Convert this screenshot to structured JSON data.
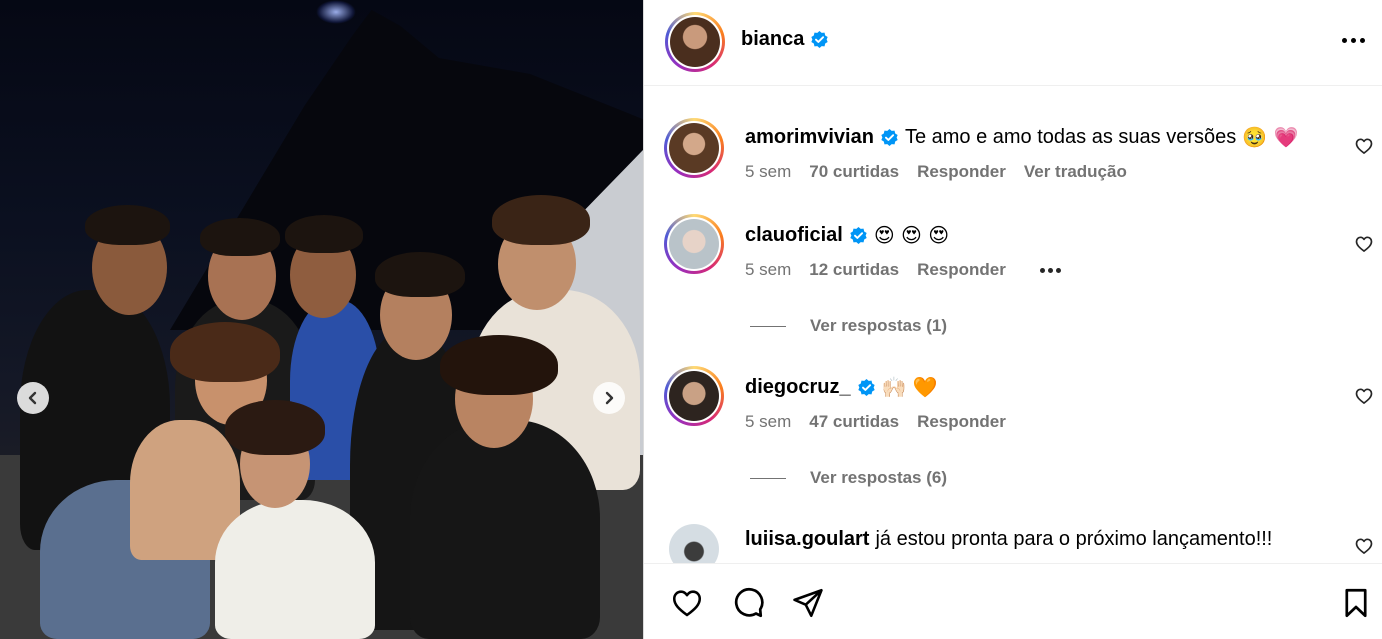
{
  "post": {
    "username": "bianca",
    "verified": true
  },
  "comments": [
    {
      "username": "amorimvivian",
      "verified": true,
      "text": "Te amo e amo todas as suas versões",
      "emoji": "🥹 💗",
      "age": "5 sem",
      "likes": "70 curtidas",
      "reply": "Responder",
      "translate": "Ver tradução"
    },
    {
      "username": "clauoficial",
      "verified": true,
      "text": "",
      "emoji": "😍 😍 😍",
      "age": "5 sem",
      "likes": "12 curtidas",
      "reply": "Responder",
      "view_replies": "Ver respostas (1)"
    },
    {
      "username": "diegocruz_",
      "verified": true,
      "text": "",
      "emoji": "🙌🏻 🧡",
      "age": "5 sem",
      "likes": "47 curtidas",
      "reply": "Responder",
      "view_replies": "Ver respostas (6)"
    },
    {
      "username": "luiisa.goulart",
      "verified": false,
      "text": "já estou pronta para o próximo lançamento!!!"
    }
  ],
  "icons": {
    "like": "heart-icon",
    "comment": "comment-icon",
    "share": "send-icon",
    "save": "bookmark-icon",
    "prev": "chevron-left-icon",
    "next": "chevron-right-icon"
  },
  "colors": {
    "verified": "#0095f6",
    "muted": "#737373",
    "border": "#dbdbdb"
  }
}
